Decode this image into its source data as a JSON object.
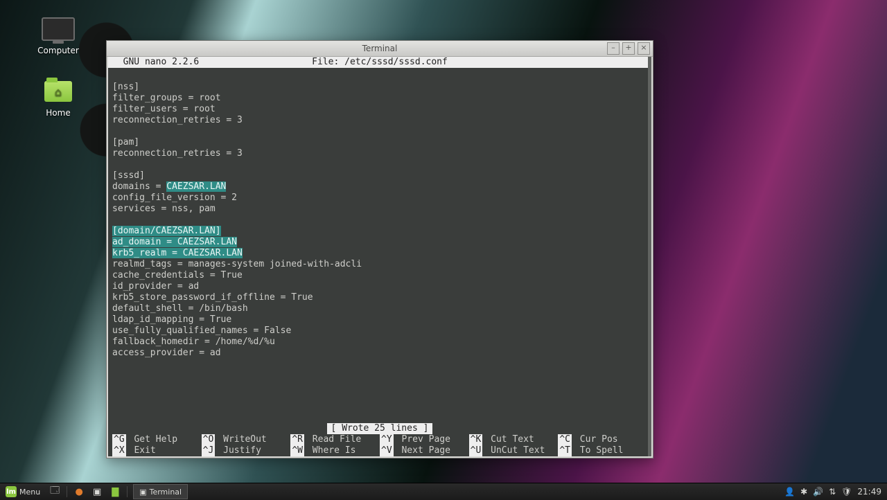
{
  "desktop": {
    "icons": {
      "computer": "Computer",
      "home": "Home"
    }
  },
  "window": {
    "title": "Terminal",
    "btn_min": "–",
    "btn_max": "+",
    "btn_close": "×"
  },
  "nano": {
    "app": "  GNU nano 2.2.6",
    "file_label": "File: /etc/sssd/sssd.conf",
    "status": "[ Wrote 25 lines ]",
    "lines": [
      {
        "t": ""
      },
      {
        "t": "[nss]"
      },
      {
        "t": "filter_groups = root"
      },
      {
        "t": "filter_users = root"
      },
      {
        "t": "reconnection_retries = 3"
      },
      {
        "t": ""
      },
      {
        "t": "[pam]"
      },
      {
        "t": "reconnection_retries = 3"
      },
      {
        "t": ""
      },
      {
        "t": "[sssd]"
      },
      {
        "pre": "domains = ",
        "hl": "CAEZSAR.LAN"
      },
      {
        "t": "config_file_version = 2"
      },
      {
        "t": "services = nss, pam"
      },
      {
        "t": ""
      },
      {
        "hl": "[domain/CAEZSAR.LAN]"
      },
      {
        "hl": "ad_domain = CAEZSAR.LAN"
      },
      {
        "hl": "krb5_realm = CAEZSAR.LAN"
      },
      {
        "t": "realmd_tags = manages-system joined-with-adcli"
      },
      {
        "t": "cache_credentials = True"
      },
      {
        "t": "id_provider = ad"
      },
      {
        "t": "krb5_store_password_if_offline = True"
      },
      {
        "t": "default_shell = /bin/bash"
      },
      {
        "t": "ldap_id_mapping = True"
      },
      {
        "t": "use_fully_qualified_names = False"
      },
      {
        "t": "fallback_homedir = /home/%d/%u"
      },
      {
        "t": "access_provider = ad"
      }
    ],
    "shortcuts_row1": [
      {
        "k": "^G",
        "l": "Get Help"
      },
      {
        "k": "^O",
        "l": "WriteOut"
      },
      {
        "k": "^R",
        "l": "Read File"
      },
      {
        "k": "^Y",
        "l": "Prev Page"
      },
      {
        "k": "^K",
        "l": "Cut Text"
      },
      {
        "k": "^C",
        "l": "Cur Pos"
      }
    ],
    "shortcuts_row2": [
      {
        "k": "^X",
        "l": "Exit"
      },
      {
        "k": "^J",
        "l": "Justify"
      },
      {
        "k": "^W",
        "l": "Where Is"
      },
      {
        "k": "^V",
        "l": "Next Page"
      },
      {
        "k": "^U",
        "l": "UnCut Text"
      },
      {
        "k": "^T",
        "l": "To Spell"
      }
    ]
  },
  "taskbar": {
    "menu": "Menu",
    "task": "Terminal",
    "clock": "21:49",
    "mint_glyph": "lm",
    "tray": {
      "user": "👤",
      "bt": "✱",
      "vol": "🔊",
      "net": "⇅",
      "shield": "🛡"
    }
  }
}
